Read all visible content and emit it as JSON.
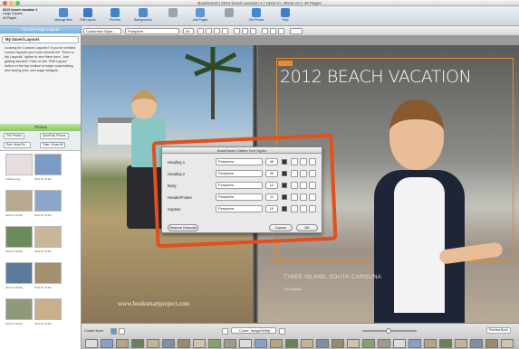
{
  "window": {
    "title": "BookSmart | 2012 beach vacation 2 | 13x11 in, 20x16 cm | 40 Pages"
  },
  "book_info": {
    "line1": "8X10 beach vacation 2",
    "line2": "Large Square",
    "line3": "40 Pages"
  },
  "toolbar": {
    "buttons": [
      {
        "name": "manage-files",
        "label": "Manage files",
        "icon": "folder-icon",
        "color": "#4a8ad0"
      },
      {
        "name": "edit-layout",
        "label": "Edit Layout",
        "icon": "layout-icon",
        "color": "#3b78c3"
      },
      {
        "name": "preview",
        "label": "Preview",
        "icon": "eye-icon",
        "color": "#3f86c9"
      },
      {
        "name": "backgrounds",
        "label": "Backgrounds",
        "icon": "background-icon",
        "color": "#4b8cd1"
      },
      {
        "name": "pages",
        "label": "",
        "icon": "page-icon",
        "color": "#9aa4ae"
      },
      {
        "name": "add-pages",
        "label": "Add Pages",
        "icon": "add-page-icon",
        "color": "#5f97d6"
      },
      {
        "name": "undo",
        "label": "",
        "icon": "undo-icon",
        "color": "#9aa4ae"
      },
      {
        "name": "get-photos",
        "label": "Get Photos",
        "icon": "cloud-icon",
        "color": "#3b8ad6"
      },
      {
        "name": "help",
        "label": "Help",
        "icon": "help-icon",
        "color": "#3c7fcf"
      }
    ]
  },
  "formatbar": {
    "style_select": "Customize Style...",
    "font_select": "Pompiere",
    "size_value": "40"
  },
  "sidebar": {
    "header": "Choose Page Layout",
    "layout_select": "My Saved Layouts",
    "custom_text": "Looking for Custom Layouts? If you've created custom layouts you must choose the \"Save to My Layouts\" option to see them here. Just getting started? Click on the \"Edit Layout\" button in the top toolbar to begin customizing and saving your own page designs.",
    "photos_header": "Photos",
    "add_photos": "Get Photos",
    "autoflow": "AutoFlow Photos",
    "sort_label": "Sort: Most Re...",
    "filter_label": "Filter: Show All",
    "thumbnails": [
      {
        "caption": "Untitled-1.jpg"
      },
      {
        "caption": "2012-07-30 Be..."
      },
      {
        "caption": "2012-07-30 Be..."
      },
      {
        "caption": "2012-07-30 Be..."
      },
      {
        "caption": "2012-07-30 Be..."
      },
      {
        "caption": "2012-07-30 Be..."
      },
      {
        "caption": "2012-07-30 Be..."
      },
      {
        "caption": "2012-07-30 Be..."
      },
      {
        "caption": "2012-07-30 Be..."
      },
      {
        "caption": "2012-07-30 Be..."
      }
    ]
  },
  "spread": {
    "left_watermark": "www.booksmartproject.com",
    "right_title": "2012 BEACH VACATION",
    "right_subtitle": "TYBEE ISLAND, SOUTH CAROLINA",
    "right_small": "Text Caption",
    "accent_color": "#e38a2c"
  },
  "dialog": {
    "title": "BookSmart: Define Text Styles",
    "rows": [
      {
        "label": "Heading 1",
        "font": "Pompiere",
        "size": "40"
      },
      {
        "label": "Heading 2",
        "font": "Pompiere",
        "size": "30"
      },
      {
        "label": "Body",
        "font": "Pompiere",
        "size": "12"
      },
      {
        "label": "Header/Footer",
        "font": "Pompiere",
        "size": "11"
      },
      {
        "label": "Caption",
        "font": "Pompiere",
        "size": "10"
      }
    ],
    "restore_label": "Restore Defaults",
    "cancel_label": "Cancel",
    "ok_label": "OK",
    "highlight_color": "#e1501e"
  },
  "bottombar": {
    "zoom_label": "Create Book",
    "nav_label": "Cover: Image/Whip",
    "preview_label": "Preview Book"
  }
}
